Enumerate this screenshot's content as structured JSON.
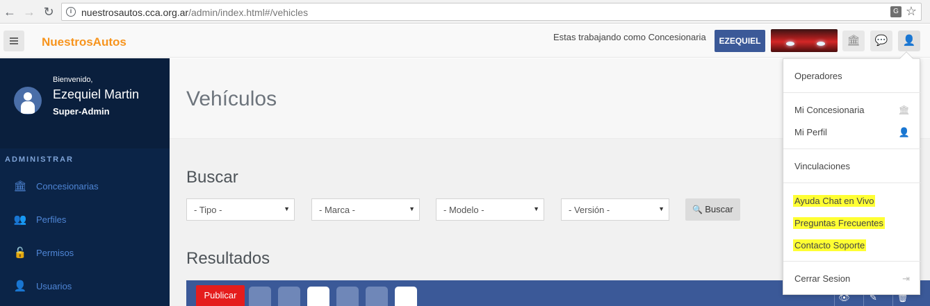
{
  "browser": {
    "url_host": "nuestrosautos.cca.org.ar",
    "url_path": "/admin/index.html#/vehicles"
  },
  "header": {
    "brand": "NuestrosAutos",
    "working_as": "Estas trabajando como Concesionaria",
    "dealer_name": "EZEQUIEL"
  },
  "sidebar": {
    "welcome": "Bienvenido,",
    "user_name": "Ezequiel Martin",
    "user_role": "Super-Admin",
    "section_title": "ADMINISTRAR",
    "items": [
      {
        "label": "Concesionarias",
        "icon": "bank-icon"
      },
      {
        "label": "Perfiles",
        "icon": "users-icon"
      },
      {
        "label": "Permisos",
        "icon": "unlock-icon"
      },
      {
        "label": "Usuarios",
        "icon": "user-icon"
      }
    ]
  },
  "main": {
    "page_title": "Vehículos",
    "search_title": "Buscar",
    "filters": [
      {
        "value": "- Tipo -"
      },
      {
        "value": "- Marca -"
      },
      {
        "value": "- Modelo -"
      },
      {
        "value": "- Versión -"
      }
    ],
    "search_button": "Buscar",
    "results_title": "Resultados",
    "publish_button": "Publicar"
  },
  "dropdown": {
    "items": [
      {
        "label": "Operadores"
      },
      {
        "label": "Mi Concesionaria",
        "icon": "bank-icon"
      },
      {
        "label": "Mi Perfil",
        "icon": "user-icon"
      },
      {
        "label": "Vinculaciones"
      },
      {
        "label": "Ayuda Chat en Vivo",
        "highlighted": true
      },
      {
        "label": "Preguntas Frecuentes",
        "highlighted": true
      },
      {
        "label": "Contacto Soporte",
        "highlighted": true
      },
      {
        "label": "Cerrar Sesion",
        "icon": "sign-out-icon"
      }
    ]
  },
  "colors": {
    "brand": "#f7941d",
    "sidebar_bg": "#0b2447",
    "dealer_badge": "#3b5998",
    "publish": "#e51d1d",
    "highlight": "#ffff33"
  }
}
